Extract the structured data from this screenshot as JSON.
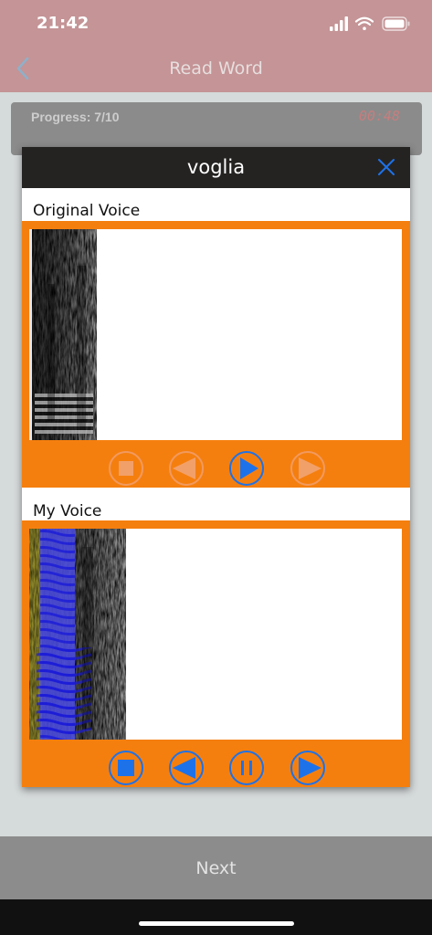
{
  "status_bar": {
    "time": "21:42",
    "icons": [
      "signal-icon",
      "wifi-icon",
      "battery-icon"
    ]
  },
  "nav": {
    "back_icon": "chevron-left-icon",
    "title": "Read Word"
  },
  "progress": {
    "label": "Progress: 7/10",
    "timer": "00:48"
  },
  "dialog": {
    "word": "voglia",
    "close_icon": "close-icon",
    "original": {
      "label": "Original Voice",
      "controls": [
        {
          "name": "stop",
          "icon": "stop-icon",
          "enabled": false
        },
        {
          "name": "rewind",
          "icon": "rewind-icon",
          "enabled": false
        },
        {
          "name": "play",
          "icon": "play-icon",
          "enabled": true
        },
        {
          "name": "forward",
          "icon": "forward-icon",
          "enabled": false
        }
      ]
    },
    "mine": {
      "label": "My Voice",
      "controls": [
        {
          "name": "stop",
          "icon": "stop-icon",
          "enabled": true
        },
        {
          "name": "rewind",
          "icon": "rewind-icon",
          "enabled": true
        },
        {
          "name": "pause",
          "icon": "pause-icon",
          "enabled": true
        },
        {
          "name": "forward",
          "icon": "forward-icon",
          "enabled": true
        }
      ]
    }
  },
  "footer": {
    "next_label": "Next"
  },
  "colors": {
    "nav_bg": "#c49496",
    "panel_orange": "#f57f0e",
    "control_blue": "#1d72ea",
    "dialog_header": "#252322",
    "footer_bg": "#8c8c8c"
  }
}
